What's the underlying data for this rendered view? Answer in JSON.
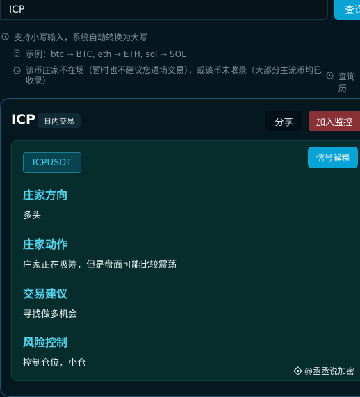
{
  "search": {
    "value": "ICP",
    "button_label": "查询"
  },
  "hints": {
    "line1": "支持小写输入，系统自动转换为大写",
    "line2": "示例：btc → BTC, eth → ETH, sol → SOL",
    "line3": "该币庄家不在场（暂时也不建议您进场交易），或该币未收录（大部分主流币均已收录）",
    "line4": "查询历"
  },
  "card": {
    "title": "ICP",
    "badge": "日内交易",
    "share_label": "分享",
    "monitor_label": "加入监控",
    "symbol": "ICPUSDT",
    "signal_label": "信号解释",
    "sections": [
      {
        "title": "庄家方向",
        "text": "多头"
      },
      {
        "title": "庄家动作",
        "text": "庄家正在吸筹，但是盘面可能比较震荡"
      },
      {
        "title": "交易建议",
        "text": "寻找做多机会"
      },
      {
        "title": "风险控制",
        "text": "控制仓位，小仓"
      }
    ]
  },
  "watermark": "@丞丞说加密",
  "colors": {
    "accent": "#0aa3d6",
    "danger": "#8a3136",
    "section_title": "#52d3ee",
    "background": "#041720"
  }
}
